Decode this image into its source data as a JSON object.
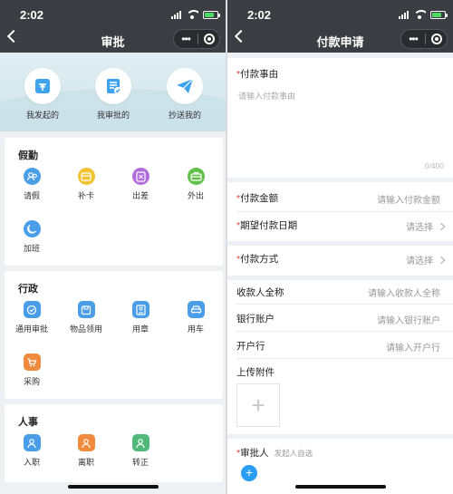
{
  "status": {
    "time": "2:02"
  },
  "left": {
    "title": "审批",
    "banner": [
      {
        "label": "我发起的",
        "icon": "upload-tray-icon"
      },
      {
        "label": "我审批的",
        "icon": "checked-doc-icon"
      },
      {
        "label": "抄送我的",
        "icon": "paper-plane-icon"
      }
    ],
    "sections": [
      {
        "title": "假勤",
        "items": [
          {
            "label": "请假",
            "icon": "leave-icon",
            "color": "#4a9ee8"
          },
          {
            "label": "补卡",
            "icon": "card-icon",
            "color": "#f1c232"
          },
          {
            "label": "出差",
            "icon": "trip-icon",
            "color": "#b06cd9"
          },
          {
            "label": "外出",
            "icon": "briefcase-icon",
            "color": "#62c04a"
          },
          {
            "label": "加班",
            "icon": "moon-icon",
            "color": "#4a9ee8"
          }
        ]
      },
      {
        "title": "行政",
        "items": [
          {
            "label": "通用审批",
            "icon": "approve-icon",
            "color": "#4a9ee8"
          },
          {
            "label": "物品领用",
            "icon": "item-icon",
            "color": "#4a9ee8"
          },
          {
            "label": "用章",
            "icon": "stamp-icon",
            "color": "#4a9ee8"
          },
          {
            "label": "用车",
            "icon": "car-icon",
            "color": "#4a9ee8"
          },
          {
            "label": "采购",
            "icon": "cart-icon",
            "color": "#f08a3c"
          }
        ]
      },
      {
        "title": "人事",
        "items": [
          {
            "label": "入职",
            "icon": "onboard-icon",
            "color": "#4a9ee8"
          },
          {
            "label": "离职",
            "icon": "resign-icon",
            "color": "#f08a3c"
          },
          {
            "label": "转正",
            "icon": "regularize-icon",
            "color": "#4fb87a"
          }
        ]
      }
    ]
  },
  "right": {
    "title": "付款申请",
    "reason": {
      "label": "付款事由",
      "placeholder": "请输入付款事由",
      "counter": "0/400"
    },
    "amount": {
      "label": "付款金额",
      "placeholder": "请输入付款金额"
    },
    "date": {
      "label": "期望付款日期",
      "value": "请选择"
    },
    "method": {
      "label": "付款方式",
      "value": "请选择"
    },
    "payee": {
      "label": "收款人全称",
      "placeholder": "请输入收款人全称"
    },
    "account": {
      "label": "银行账户",
      "placeholder": "请输入银行账户"
    },
    "bank": {
      "label": "开户行",
      "placeholder": "请输入开户行"
    },
    "attachment": {
      "label": "上传附件",
      "add": "+"
    },
    "approver": {
      "label": "审批人",
      "hint": "发起人自选",
      "add": "+"
    }
  },
  "colors": {
    "accent": "#2a9df4",
    "required": "#e23c3c",
    "topbar": "#3c3d42"
  }
}
